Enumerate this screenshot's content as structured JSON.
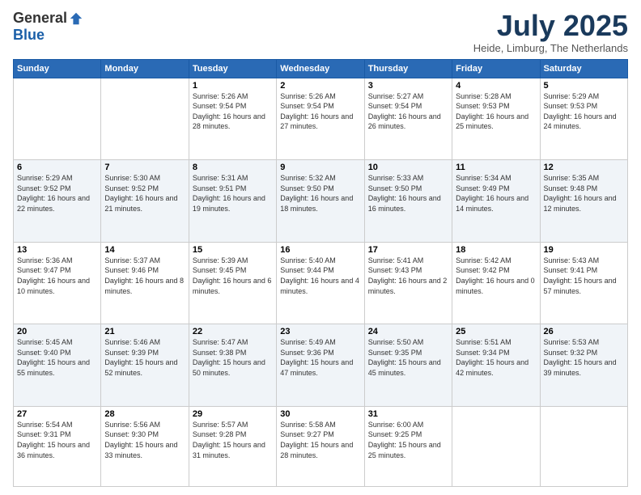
{
  "logo": {
    "general": "General",
    "blue": "Blue"
  },
  "header": {
    "month": "July 2025",
    "location": "Heide, Limburg, The Netherlands"
  },
  "weekdays": [
    "Sunday",
    "Monday",
    "Tuesday",
    "Wednesday",
    "Thursday",
    "Friday",
    "Saturday"
  ],
  "weeks": [
    [
      {
        "day": "",
        "sunrise": "",
        "sunset": "",
        "daylight": ""
      },
      {
        "day": "",
        "sunrise": "",
        "sunset": "",
        "daylight": ""
      },
      {
        "day": "1",
        "sunrise": "Sunrise: 5:26 AM",
        "sunset": "Sunset: 9:54 PM",
        "daylight": "Daylight: 16 hours and 28 minutes."
      },
      {
        "day": "2",
        "sunrise": "Sunrise: 5:26 AM",
        "sunset": "Sunset: 9:54 PM",
        "daylight": "Daylight: 16 hours and 27 minutes."
      },
      {
        "day": "3",
        "sunrise": "Sunrise: 5:27 AM",
        "sunset": "Sunset: 9:54 PM",
        "daylight": "Daylight: 16 hours and 26 minutes."
      },
      {
        "day": "4",
        "sunrise": "Sunrise: 5:28 AM",
        "sunset": "Sunset: 9:53 PM",
        "daylight": "Daylight: 16 hours and 25 minutes."
      },
      {
        "day": "5",
        "sunrise": "Sunrise: 5:29 AM",
        "sunset": "Sunset: 9:53 PM",
        "daylight": "Daylight: 16 hours and 24 minutes."
      }
    ],
    [
      {
        "day": "6",
        "sunrise": "Sunrise: 5:29 AM",
        "sunset": "Sunset: 9:52 PM",
        "daylight": "Daylight: 16 hours and 22 minutes."
      },
      {
        "day": "7",
        "sunrise": "Sunrise: 5:30 AM",
        "sunset": "Sunset: 9:52 PM",
        "daylight": "Daylight: 16 hours and 21 minutes."
      },
      {
        "day": "8",
        "sunrise": "Sunrise: 5:31 AM",
        "sunset": "Sunset: 9:51 PM",
        "daylight": "Daylight: 16 hours and 19 minutes."
      },
      {
        "day": "9",
        "sunrise": "Sunrise: 5:32 AM",
        "sunset": "Sunset: 9:50 PM",
        "daylight": "Daylight: 16 hours and 18 minutes."
      },
      {
        "day": "10",
        "sunrise": "Sunrise: 5:33 AM",
        "sunset": "Sunset: 9:50 PM",
        "daylight": "Daylight: 16 hours and 16 minutes."
      },
      {
        "day": "11",
        "sunrise": "Sunrise: 5:34 AM",
        "sunset": "Sunset: 9:49 PM",
        "daylight": "Daylight: 16 hours and 14 minutes."
      },
      {
        "day": "12",
        "sunrise": "Sunrise: 5:35 AM",
        "sunset": "Sunset: 9:48 PM",
        "daylight": "Daylight: 16 hours and 12 minutes."
      }
    ],
    [
      {
        "day": "13",
        "sunrise": "Sunrise: 5:36 AM",
        "sunset": "Sunset: 9:47 PM",
        "daylight": "Daylight: 16 hours and 10 minutes."
      },
      {
        "day": "14",
        "sunrise": "Sunrise: 5:37 AM",
        "sunset": "Sunset: 9:46 PM",
        "daylight": "Daylight: 16 hours and 8 minutes."
      },
      {
        "day": "15",
        "sunrise": "Sunrise: 5:39 AM",
        "sunset": "Sunset: 9:45 PM",
        "daylight": "Daylight: 16 hours and 6 minutes."
      },
      {
        "day": "16",
        "sunrise": "Sunrise: 5:40 AM",
        "sunset": "Sunset: 9:44 PM",
        "daylight": "Daylight: 16 hours and 4 minutes."
      },
      {
        "day": "17",
        "sunrise": "Sunrise: 5:41 AM",
        "sunset": "Sunset: 9:43 PM",
        "daylight": "Daylight: 16 hours and 2 minutes."
      },
      {
        "day": "18",
        "sunrise": "Sunrise: 5:42 AM",
        "sunset": "Sunset: 9:42 PM",
        "daylight": "Daylight: 16 hours and 0 minutes."
      },
      {
        "day": "19",
        "sunrise": "Sunrise: 5:43 AM",
        "sunset": "Sunset: 9:41 PM",
        "daylight": "Daylight: 15 hours and 57 minutes."
      }
    ],
    [
      {
        "day": "20",
        "sunrise": "Sunrise: 5:45 AM",
        "sunset": "Sunset: 9:40 PM",
        "daylight": "Daylight: 15 hours and 55 minutes."
      },
      {
        "day": "21",
        "sunrise": "Sunrise: 5:46 AM",
        "sunset": "Sunset: 9:39 PM",
        "daylight": "Daylight: 15 hours and 52 minutes."
      },
      {
        "day": "22",
        "sunrise": "Sunrise: 5:47 AM",
        "sunset": "Sunset: 9:38 PM",
        "daylight": "Daylight: 15 hours and 50 minutes."
      },
      {
        "day": "23",
        "sunrise": "Sunrise: 5:49 AM",
        "sunset": "Sunset: 9:36 PM",
        "daylight": "Daylight: 15 hours and 47 minutes."
      },
      {
        "day": "24",
        "sunrise": "Sunrise: 5:50 AM",
        "sunset": "Sunset: 9:35 PM",
        "daylight": "Daylight: 15 hours and 45 minutes."
      },
      {
        "day": "25",
        "sunrise": "Sunrise: 5:51 AM",
        "sunset": "Sunset: 9:34 PM",
        "daylight": "Daylight: 15 hours and 42 minutes."
      },
      {
        "day": "26",
        "sunrise": "Sunrise: 5:53 AM",
        "sunset": "Sunset: 9:32 PM",
        "daylight": "Daylight: 15 hours and 39 minutes."
      }
    ],
    [
      {
        "day": "27",
        "sunrise": "Sunrise: 5:54 AM",
        "sunset": "Sunset: 9:31 PM",
        "daylight": "Daylight: 15 hours and 36 minutes."
      },
      {
        "day": "28",
        "sunrise": "Sunrise: 5:56 AM",
        "sunset": "Sunset: 9:30 PM",
        "daylight": "Daylight: 15 hours and 33 minutes."
      },
      {
        "day": "29",
        "sunrise": "Sunrise: 5:57 AM",
        "sunset": "Sunset: 9:28 PM",
        "daylight": "Daylight: 15 hours and 31 minutes."
      },
      {
        "day": "30",
        "sunrise": "Sunrise: 5:58 AM",
        "sunset": "Sunset: 9:27 PM",
        "daylight": "Daylight: 15 hours and 28 minutes."
      },
      {
        "day": "31",
        "sunrise": "Sunrise: 6:00 AM",
        "sunset": "Sunset: 9:25 PM",
        "daylight": "Daylight: 15 hours and 25 minutes."
      },
      {
        "day": "",
        "sunrise": "",
        "sunset": "",
        "daylight": ""
      },
      {
        "day": "",
        "sunrise": "",
        "sunset": "",
        "daylight": ""
      }
    ]
  ]
}
